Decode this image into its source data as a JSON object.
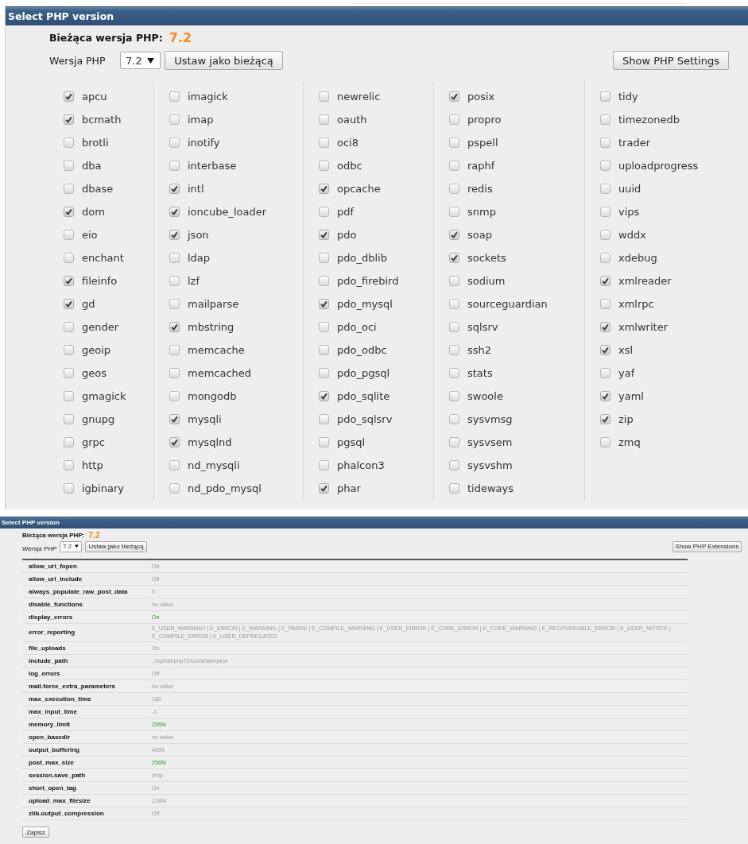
{
  "extensions_view": {
    "title": "Select PHP version",
    "current": {
      "label": "Bieżąca wersja PHP:",
      "version": "7.2"
    },
    "version_select": {
      "label": "Wersja PHP",
      "value": "7.2"
    },
    "set_button": "Ustaw jako bieżącą",
    "toggle_button": "Show PHP Settings",
    "columns": [
      {
        "extensions": [
          {
            "name": "apcu",
            "checked": true
          },
          {
            "name": "bcmath",
            "checked": true
          },
          {
            "name": "brotli",
            "checked": false
          },
          {
            "name": "dba",
            "checked": false
          },
          {
            "name": "dbase",
            "checked": false
          },
          {
            "name": "dom",
            "checked": true
          },
          {
            "name": "eio",
            "checked": false
          },
          {
            "name": "enchant",
            "checked": false
          },
          {
            "name": "fileinfo",
            "checked": true
          },
          {
            "name": "gd",
            "checked": true
          },
          {
            "name": "gender",
            "checked": false
          },
          {
            "name": "geoip",
            "checked": false
          },
          {
            "name": "geos",
            "checked": false
          },
          {
            "name": "gmagick",
            "checked": false
          },
          {
            "name": "gnupg",
            "checked": false
          },
          {
            "name": "grpc",
            "checked": false
          },
          {
            "name": "http",
            "checked": false
          },
          {
            "name": "igbinary",
            "checked": false
          }
        ]
      },
      {
        "extensions": [
          {
            "name": "imagick",
            "checked": false
          },
          {
            "name": "imap",
            "checked": false
          },
          {
            "name": "inotify",
            "checked": false
          },
          {
            "name": "interbase",
            "checked": false
          },
          {
            "name": "intl",
            "checked": true
          },
          {
            "name": "ioncube_loader",
            "checked": true
          },
          {
            "name": "json",
            "checked": true
          },
          {
            "name": "ldap",
            "checked": false
          },
          {
            "name": "lzf",
            "checked": false
          },
          {
            "name": "mailparse",
            "checked": false
          },
          {
            "name": "mbstring",
            "checked": true
          },
          {
            "name": "memcache",
            "checked": false
          },
          {
            "name": "memcached",
            "checked": false
          },
          {
            "name": "mongodb",
            "checked": false
          },
          {
            "name": "mysqli",
            "checked": true
          },
          {
            "name": "mysqlnd",
            "checked": true
          },
          {
            "name": "nd_mysqli",
            "checked": false
          },
          {
            "name": "nd_pdo_mysql",
            "checked": false
          }
        ]
      },
      {
        "extensions": [
          {
            "name": "newrelic",
            "checked": false
          },
          {
            "name": "oauth",
            "checked": false
          },
          {
            "name": "oci8",
            "checked": false
          },
          {
            "name": "odbc",
            "checked": false
          },
          {
            "name": "opcache",
            "checked": true
          },
          {
            "name": "pdf",
            "checked": false
          },
          {
            "name": "pdo",
            "checked": true
          },
          {
            "name": "pdo_dblib",
            "checked": false
          },
          {
            "name": "pdo_firebird",
            "checked": false
          },
          {
            "name": "pdo_mysql",
            "checked": true
          },
          {
            "name": "pdo_oci",
            "checked": false
          },
          {
            "name": "pdo_odbc",
            "checked": false
          },
          {
            "name": "pdo_pgsql",
            "checked": false
          },
          {
            "name": "pdo_sqlite",
            "checked": true
          },
          {
            "name": "pdo_sqlsrv",
            "checked": false
          },
          {
            "name": "pgsql",
            "checked": false
          },
          {
            "name": "phalcon3",
            "checked": false
          },
          {
            "name": "phar",
            "checked": true
          }
        ]
      },
      {
        "extensions": [
          {
            "name": "posix",
            "checked": true
          },
          {
            "name": "propro",
            "checked": false
          },
          {
            "name": "pspell",
            "checked": false
          },
          {
            "name": "raphf",
            "checked": false
          },
          {
            "name": "redis",
            "checked": false
          },
          {
            "name": "snmp",
            "checked": false
          },
          {
            "name": "soap",
            "checked": true
          },
          {
            "name": "sockets",
            "checked": true
          },
          {
            "name": "sodium",
            "checked": false
          },
          {
            "name": "sourceguardian",
            "checked": false
          },
          {
            "name": "sqlsrv",
            "checked": false
          },
          {
            "name": "ssh2",
            "checked": false
          },
          {
            "name": "stats",
            "checked": false
          },
          {
            "name": "swoole",
            "checked": false
          },
          {
            "name": "sysvmsg",
            "checked": false
          },
          {
            "name": "sysvsem",
            "checked": false
          },
          {
            "name": "sysvshm",
            "checked": false
          },
          {
            "name": "tideways",
            "checked": false
          }
        ]
      },
      {
        "extensions": [
          {
            "name": "tidy",
            "checked": false
          },
          {
            "name": "timezonedb",
            "checked": false
          },
          {
            "name": "trader",
            "checked": false
          },
          {
            "name": "uploadprogress",
            "checked": false
          },
          {
            "name": "uuid",
            "checked": false
          },
          {
            "name": "vips",
            "checked": false
          },
          {
            "name": "wddx",
            "checked": false
          },
          {
            "name": "xdebug",
            "checked": false
          },
          {
            "name": "xmlreader",
            "checked": true
          },
          {
            "name": "xmlrpc",
            "checked": false
          },
          {
            "name": "xmlwriter",
            "checked": true
          },
          {
            "name": "xsl",
            "checked": true
          },
          {
            "name": "yaf",
            "checked": false
          },
          {
            "name": "yaml",
            "checked": true
          },
          {
            "name": "zip",
            "checked": true
          },
          {
            "name": "zmq",
            "checked": false
          }
        ]
      }
    ]
  },
  "settings_view": {
    "title": "Select PHP version",
    "current": {
      "label": "Bieżąca wersja PHP:",
      "version": "7.2"
    },
    "version_select": {
      "label": "Wersja PHP",
      "value": "7.2"
    },
    "set_button": "Ustaw jako bieżącą",
    "toggle_button": "Show PHP Extensions",
    "settings": [
      {
        "name": "allow_url_fopen",
        "value": "On",
        "highlighted": false
      },
      {
        "name": "allow_url_include",
        "value": "Off",
        "highlighted": false
      },
      {
        "name": "always_populate_raw_post_data",
        "value": "0",
        "highlighted": false
      },
      {
        "name": "disable_functions",
        "value": "no value",
        "highlighted": false
      },
      {
        "name": "display_errors",
        "value": "On",
        "highlighted": true
      },
      {
        "name": "error_reporting",
        "value": "E_USER_WARNING | E_ERROR | E_WARNING | E_PARSE | E_COMPILE_WARNING | E_USER_ERROR | E_CORE_ERROR | E_CORE_WARNING | E_RECOVERABLE_ERROR | E_USER_NOTICE | E_COMPILE_ERROR | E_USER_DEPRECATED",
        "highlighted": false
      },
      {
        "name": "file_uploads",
        "value": "On",
        "highlighted": false
      },
      {
        "name": "include_path",
        "value": ".:/opt/alt/php72/usr/share/pear",
        "highlighted": false
      },
      {
        "name": "log_errors",
        "value": "Off",
        "highlighted": false
      },
      {
        "name": "mail.force_extra_parameters",
        "value": "no value",
        "highlighted": false
      },
      {
        "name": "max_execution_time",
        "value": "180",
        "highlighted": false
      },
      {
        "name": "max_input_time",
        "value": "-1",
        "highlighted": false
      },
      {
        "name": "memory_limit",
        "value": "256M",
        "highlighted": true
      },
      {
        "name": "open_basedir",
        "value": "no value",
        "highlighted": false
      },
      {
        "name": "output_buffering",
        "value": "4096",
        "highlighted": false
      },
      {
        "name": "post_max_size",
        "value": "256M",
        "highlighted": true
      },
      {
        "name": "session.save_path",
        "value": "/tmp",
        "highlighted": false
      },
      {
        "name": "short_open_tag",
        "value": "On",
        "highlighted": false
      },
      {
        "name": "upload_max_filesize",
        "value": "128M",
        "highlighted": false
      },
      {
        "name": "zlib.output_compression",
        "value": "Off",
        "highlighted": false
      }
    ],
    "save_button": "Zapisz"
  }
}
